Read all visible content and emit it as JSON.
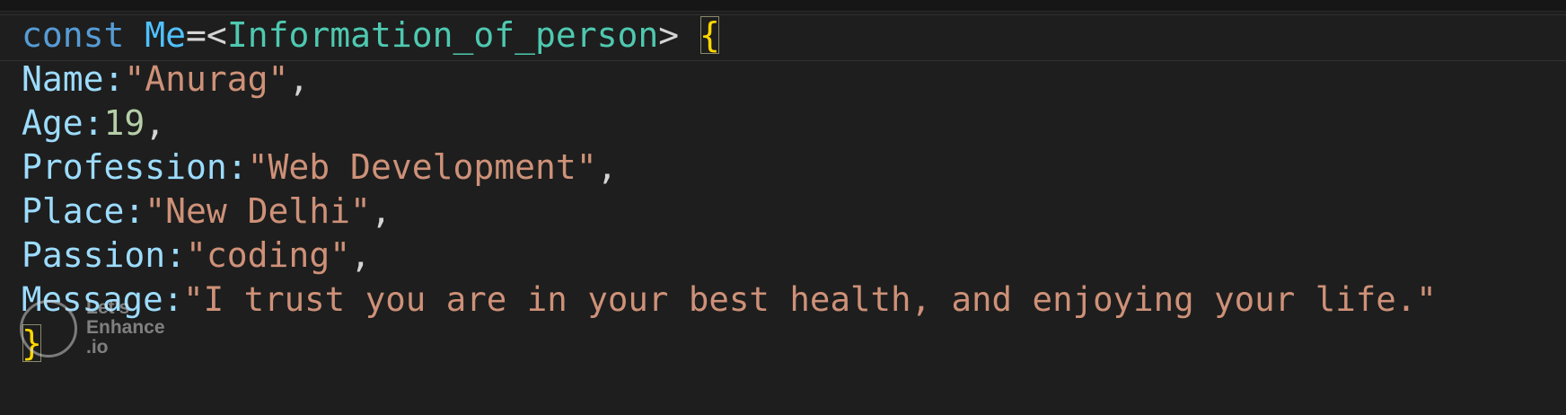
{
  "code": {
    "line1": {
      "keyword": "const",
      "variable": "Me",
      "equals_open": "=<",
      "type": "Information_of_person",
      "close_gt": ">",
      "open_brace": "{"
    },
    "lines": [
      {
        "key": "Name",
        "colon": ":",
        "value": "\"Anurag\"",
        "trail": ",",
        "kind": "str"
      },
      {
        "key": "Age",
        "colon": ":",
        "value": "19",
        "trail": ",",
        "kind": "num"
      },
      {
        "key": "Profession",
        "colon": ":",
        "value": "\"Web Development\"",
        "trail": ",",
        "kind": "str"
      },
      {
        "key": "Place",
        "colon": ":",
        "value": "\"New Delhi\"",
        "trail": ",",
        "kind": "str"
      },
      {
        "key": "Passion",
        "colon": ":",
        "value": "\"coding\"",
        "trail": ",",
        "kind": "str"
      },
      {
        "key": "Message",
        "colon": ":",
        "value": "\"I trust you are in your best health, and enjoying your life.\"",
        "trail": "",
        "kind": "str"
      }
    ],
    "close_brace": "}"
  },
  "watermark": {
    "line1": "Let's",
    "line2": "Enhance",
    "line3": ".io"
  },
  "colors": {
    "background": "#1e1e1e",
    "keyword": "#569cd6",
    "variable": "#4fc1ff",
    "type": "#4ec9b0",
    "property": "#9cdcfe",
    "string": "#ce9178",
    "number": "#b5cea8",
    "brace": "#ffd700"
  }
}
